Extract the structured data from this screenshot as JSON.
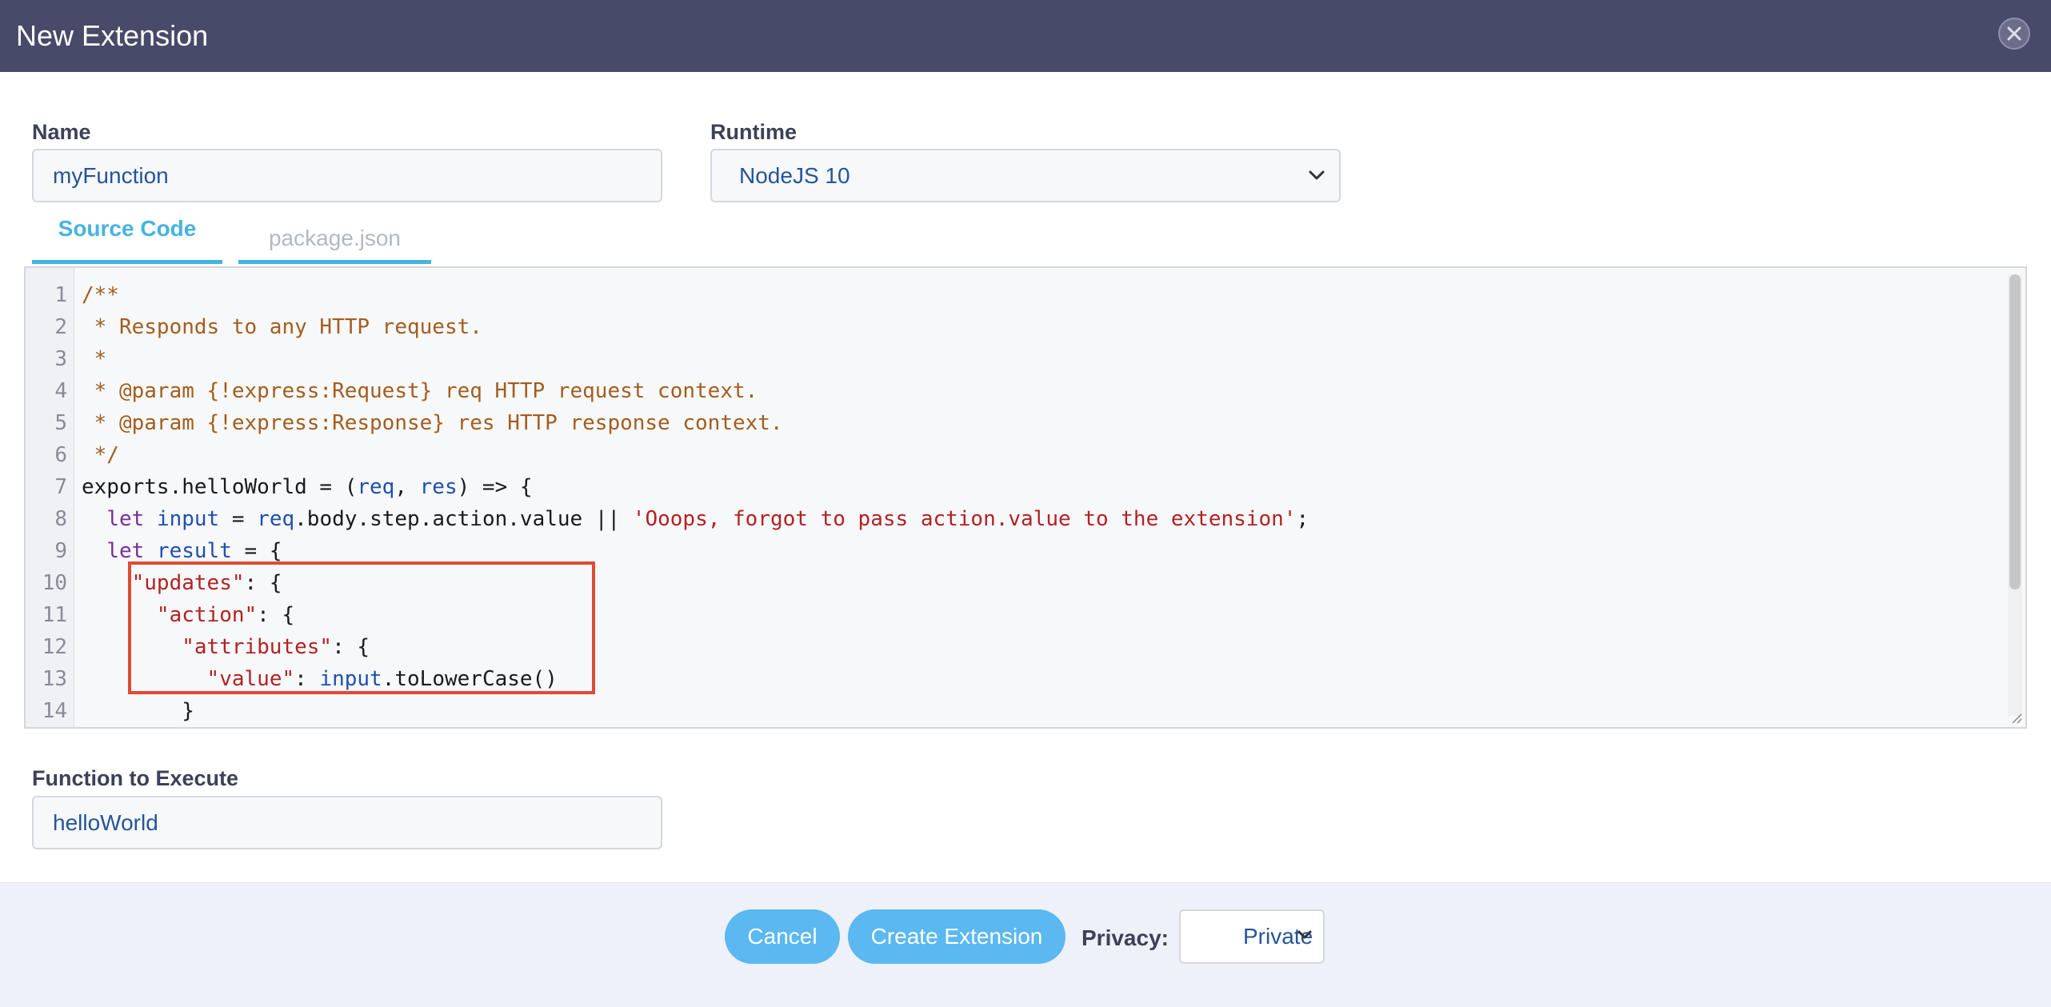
{
  "window": {
    "title": "New Extension"
  },
  "form": {
    "name_label": "Name",
    "name_value": "myFunction",
    "runtime_label": "Runtime",
    "runtime_value": "NodeJS 10",
    "function_label": "Function to Execute",
    "function_value": "helloWorld"
  },
  "tabs": [
    {
      "label": "Source Code",
      "active": true
    },
    {
      "label": "package.json",
      "active": false
    }
  ],
  "editor": {
    "lines": [
      {
        "n": "1",
        "tokens": [
          [
            "comment",
            "/**"
          ]
        ]
      },
      {
        "n": "2",
        "tokens": [
          [
            "comment",
            " * Responds to any HTTP request."
          ]
        ]
      },
      {
        "n": "3",
        "tokens": [
          [
            "comment",
            " *"
          ]
        ]
      },
      {
        "n": "4",
        "tokens": [
          [
            "comment",
            " * @param {!express:Request} req HTTP request context."
          ]
        ]
      },
      {
        "n": "5",
        "tokens": [
          [
            "comment",
            " * @param {!express:Response} res HTTP response context."
          ]
        ]
      },
      {
        "n": "6",
        "tokens": [
          [
            "comment",
            " */"
          ]
        ]
      },
      {
        "n": "7",
        "tokens": [
          [
            "plain",
            "exports.helloWorld = ("
          ],
          [
            "var",
            "req"
          ],
          [
            "plain",
            ", "
          ],
          [
            "var",
            "res"
          ],
          [
            "plain",
            ") => {"
          ]
        ]
      },
      {
        "n": "8",
        "tokens": [
          [
            "plain",
            "  "
          ],
          [
            "kw",
            "let"
          ],
          [
            "plain",
            " "
          ],
          [
            "var",
            "input"
          ],
          [
            "plain",
            " = "
          ],
          [
            "var",
            "req"
          ],
          [
            "plain",
            ".body.step.action.value || "
          ],
          [
            "str",
            "'Ooops, forgot to pass action.value to the extension'"
          ],
          [
            "plain",
            ";"
          ]
        ]
      },
      {
        "n": "9",
        "tokens": [
          [
            "plain",
            "  "
          ],
          [
            "kw",
            "let"
          ],
          [
            "plain",
            " "
          ],
          [
            "var",
            "result"
          ],
          [
            "plain",
            " = {"
          ]
        ]
      },
      {
        "n": "10",
        "tokens": [
          [
            "plain",
            "    "
          ],
          [
            "str",
            "\"updates\""
          ],
          [
            "plain",
            ": {"
          ]
        ]
      },
      {
        "n": "11",
        "tokens": [
          [
            "plain",
            "      "
          ],
          [
            "str",
            "\"action\""
          ],
          [
            "plain",
            ": {"
          ]
        ]
      },
      {
        "n": "12",
        "tokens": [
          [
            "plain",
            "        "
          ],
          [
            "str",
            "\"attributes\""
          ],
          [
            "plain",
            ": {"
          ]
        ]
      },
      {
        "n": "13",
        "tokens": [
          [
            "plain",
            "          "
          ],
          [
            "str",
            "\"value\""
          ],
          [
            "plain",
            ": "
          ],
          [
            "var",
            "input"
          ],
          [
            "plain",
            ".toLowerCase()"
          ]
        ]
      },
      {
        "n": "14",
        "tokens": [
          [
            "plain",
            "        }"
          ]
        ]
      }
    ],
    "highlight_color": "#e04a33"
  },
  "footer": {
    "cancel_label": "Cancel",
    "create_label": "Create Extension",
    "privacy_label": "Privacy:",
    "privacy_value": "Private"
  },
  "colors": {
    "titlebar": "#474a68",
    "accent": "#47b3e0",
    "button": "#5bb8f0"
  },
  "icons": {
    "close": "close-icon",
    "dropdown": "chevron-down-icon"
  }
}
